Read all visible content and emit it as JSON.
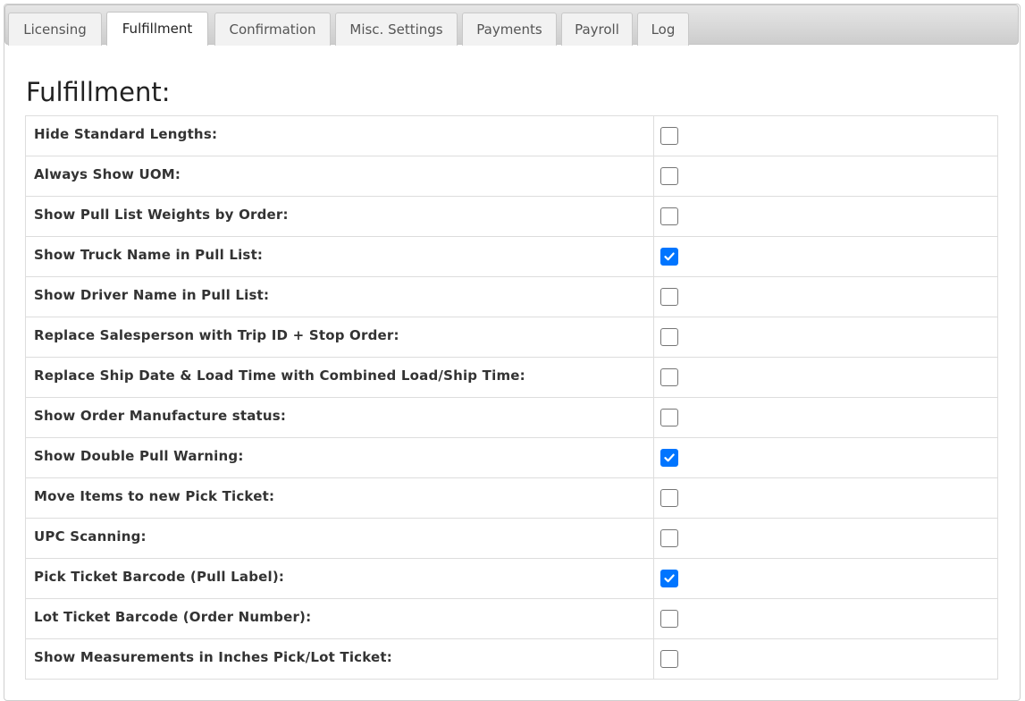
{
  "tabs": [
    {
      "label": "Licensing",
      "active": false
    },
    {
      "label": "Fulfillment",
      "active": true
    },
    {
      "label": "Confirmation",
      "active": false
    },
    {
      "label": "Misc. Settings",
      "active": false
    },
    {
      "label": "Payments",
      "active": false
    },
    {
      "label": "Payroll",
      "active": false
    },
    {
      "label": "Log",
      "active": false
    }
  ],
  "page": {
    "title": "Fulfillment:"
  },
  "settings": [
    {
      "label": "Hide Standard Lengths:",
      "checked": false
    },
    {
      "label": "Always Show UOM:",
      "checked": false
    },
    {
      "label": "Show Pull List Weights by Order:",
      "checked": false
    },
    {
      "label": "Show Truck Name in Pull List:",
      "checked": true
    },
    {
      "label": "Show Driver Name in Pull List:",
      "checked": false
    },
    {
      "label": "Replace Salesperson with Trip ID + Stop Order:",
      "checked": false
    },
    {
      "label": "Replace Ship Date & Load Time with Combined Load/Ship Time:",
      "checked": false
    },
    {
      "label": "Show Order Manufacture status:",
      "checked": false
    },
    {
      "label": "Show Double Pull Warning:",
      "checked": true
    },
    {
      "label": "Move Items to new Pick Ticket:",
      "checked": false
    },
    {
      "label": "UPC Scanning:",
      "checked": false
    },
    {
      "label": "Pick Ticket Barcode (Pull Label):",
      "checked": true
    },
    {
      "label": "Lot Ticket Barcode (Order Number):",
      "checked": false
    },
    {
      "label": "Show Measurements in Inches Pick/Lot Ticket:",
      "checked": false
    }
  ],
  "colors": {
    "checkbox_checked": "#0075ff",
    "active_tab": "#ffffff"
  }
}
